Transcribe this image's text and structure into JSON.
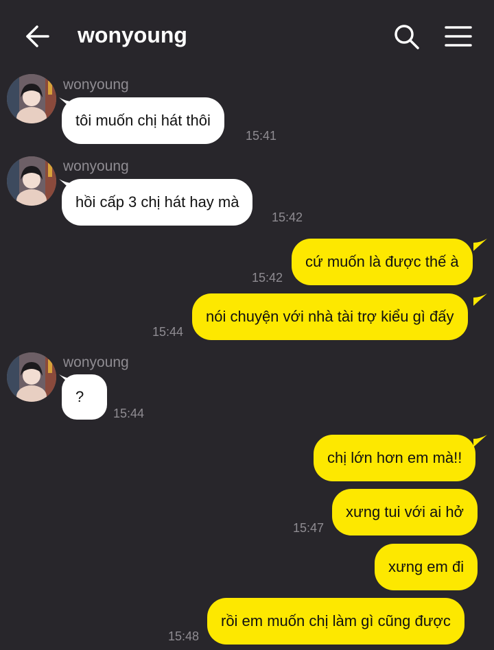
{
  "header": {
    "title": "wonyoung",
    "back_icon": "arrow-left-icon",
    "search_icon": "search-icon",
    "menu_icon": "hamburger-menu-icon"
  },
  "colors": {
    "background": "#28262b",
    "incoming_bubble": "#ffffff",
    "outgoing_bubble": "#fde800",
    "meta_text": "#8f8c92"
  },
  "messages": [
    {
      "sender": "wonyoung",
      "direction": "in",
      "text": "tôi muốn chị hát thôi",
      "time": "15:41"
    },
    {
      "sender": "wonyoung",
      "direction": "in",
      "text": "hồi cấp 3 chị hát hay mà",
      "time": "15:42"
    },
    {
      "direction": "out",
      "text": "cứ muốn là được thế à",
      "time": "15:42"
    },
    {
      "direction": "out",
      "text": "nói chuyện với nhà tài trợ kiểu gì đấy",
      "time": "15:44"
    },
    {
      "sender": "wonyoung",
      "direction": "in",
      "text": "?",
      "time": "15:44"
    },
    {
      "direction": "out",
      "text": "chị lớn hơn em mà!!",
      "time": ""
    },
    {
      "direction": "out",
      "text": "xưng tui với ai hở",
      "time": "15:47"
    },
    {
      "direction": "out",
      "text": "xưng em đi",
      "time": ""
    },
    {
      "direction": "out",
      "text": "rồi em muốn chị làm gì cũng được",
      "time": "15:48"
    }
  ]
}
